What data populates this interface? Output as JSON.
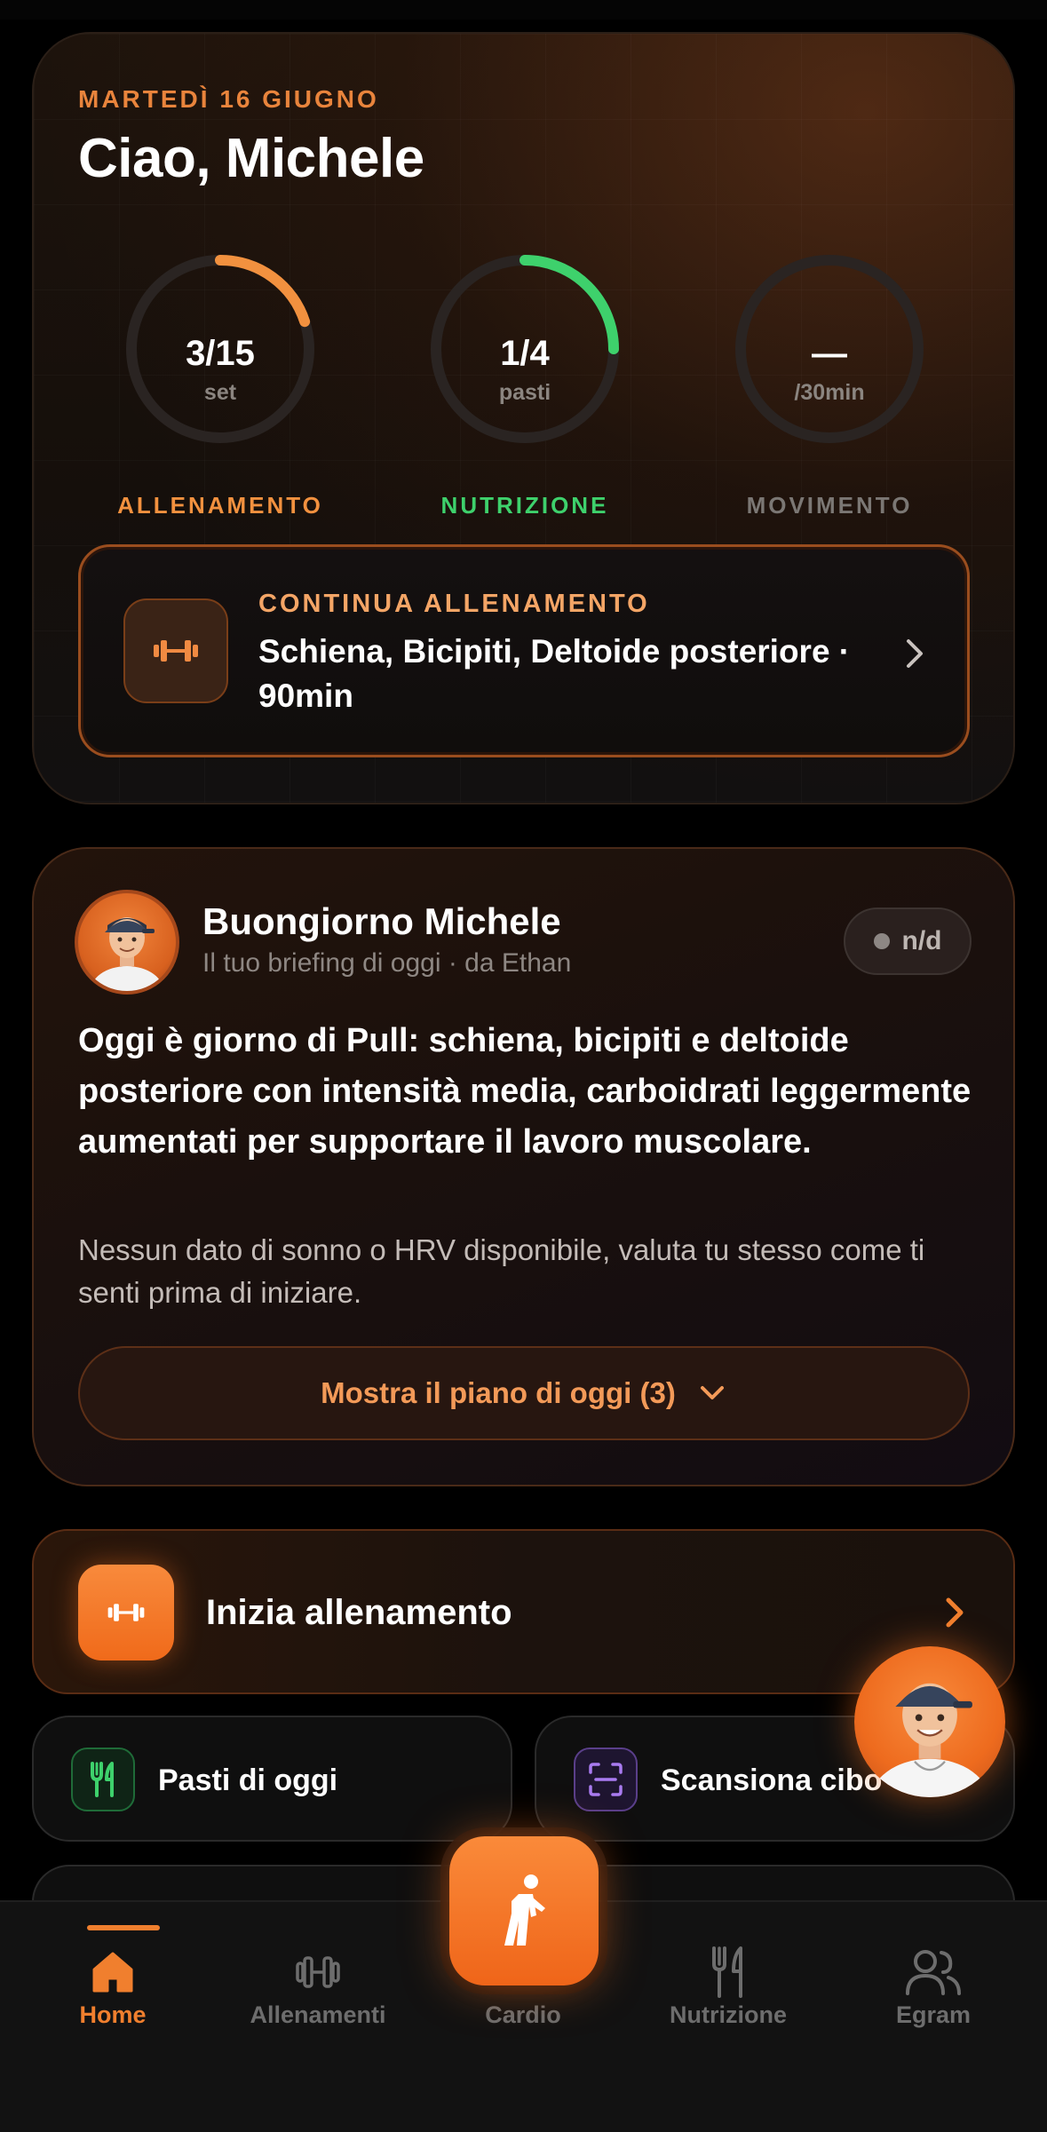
{
  "header": {
    "date": "MARTEDÌ 16 GIUGNO",
    "greeting": "Ciao, Michele"
  },
  "rings": [
    {
      "value": "3/15",
      "unit": "set",
      "label": "ALLENAMENTO",
      "color": "#f2913f",
      "progress": 0.2
    },
    {
      "value": "1/4",
      "unit": "pasti",
      "label": "NUTRIZIONE",
      "color": "#3ed16c",
      "progress": 0.25
    },
    {
      "value": "—",
      "unit": "/30min",
      "label": "MOVIMENTO",
      "color": "#7b7774",
      "progress": 0
    }
  ],
  "continue_workout": {
    "kicker": "CONTINUA ALLENAMENTO",
    "title": "Schiena, Bicipiti, Deltoide posteriore · 90min",
    "icon": "dumbbell-icon"
  },
  "briefing": {
    "name": "Buongiorno Michele",
    "subtitle": "Il tuo briefing di oggi · da Ethan",
    "status_pill": "n/d",
    "headline": "Oggi è giorno di Pull: schiena, bicipiti e deltoide posteriore con intensità media, carboidrati leggermente aumentati per supportare il lavoro muscolare.",
    "body": "Nessun dato di sonno o HRV disponibile, valuta tu stesso come ti senti prima di iniziare.",
    "plan_button": "Mostra il piano di oggi (3)"
  },
  "start_workout": {
    "label": "Inizia allenamento",
    "icon": "dumbbell-icon"
  },
  "quick_actions": [
    {
      "label": "Pasti di oggi",
      "icon": "fork-knife-icon",
      "color": "#3ed16c"
    },
    {
      "label": "Scansiona cibo",
      "icon": "scan-icon",
      "color": "#a97bf0"
    }
  ],
  "nav": {
    "items": [
      {
        "label": "Home",
        "icon": "home-icon",
        "active": true
      },
      {
        "label": "Allenamenti",
        "icon": "dumbbell-icon",
        "active": false
      },
      {
        "label": "Cardio",
        "icon": "walking-icon",
        "active": false
      },
      {
        "label": "Nutrizione",
        "icon": "fork-knife-icon",
        "active": false
      },
      {
        "label": "Egram",
        "icon": "people-icon",
        "active": false
      }
    ]
  },
  "colors": {
    "accent": "#f07f2e",
    "green": "#3ed16c",
    "purple": "#a97bf0",
    "muted": "#6d6d6d"
  }
}
